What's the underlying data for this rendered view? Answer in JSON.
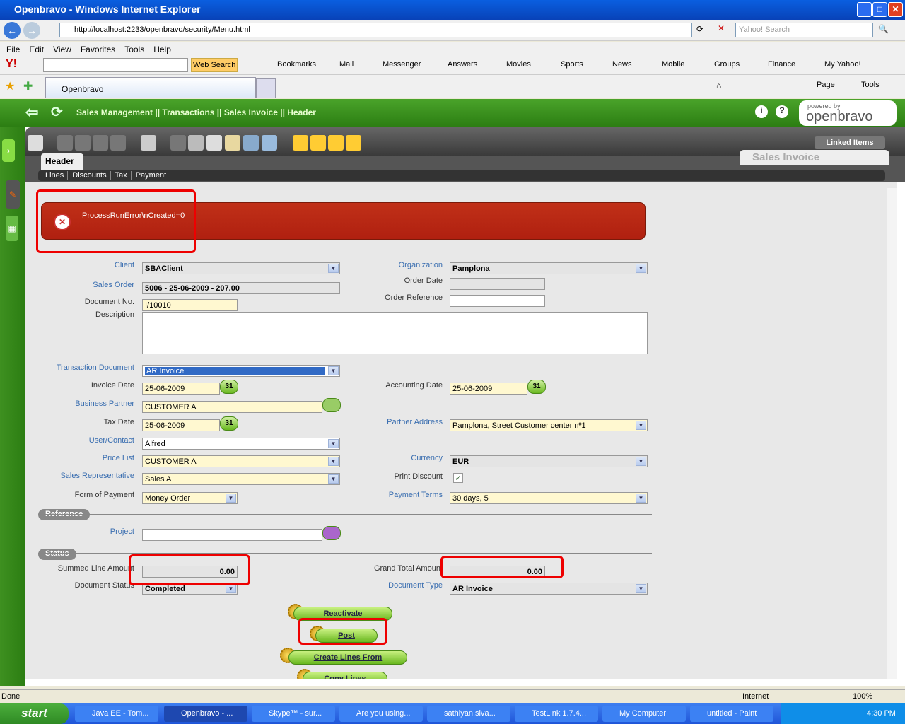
{
  "window": {
    "title": "Openbravo - Windows Internet Explorer",
    "url": "http://localhost:2233/openbravo/security/Menu.html",
    "search_placeholder": "Yahoo! Search"
  },
  "menu": [
    "File",
    "Edit",
    "View",
    "Favorites",
    "Tools",
    "Help"
  ],
  "yahoo_toolbar": {
    "web_search": "Web Search",
    "items": [
      "Bookmarks",
      "Mail",
      "Messenger",
      "Answers",
      "Movies",
      "Sports",
      "News",
      "Mobile",
      "Groups",
      "Finance",
      "My Yahoo!"
    ]
  },
  "ie_tab": "Openbravo",
  "ie_cmd": {
    "page": "Page",
    "tools": "Tools"
  },
  "app": {
    "breadcrumb": "Sales Management || Transactions || Sales Invoice || Header",
    "powered_by": "powered by",
    "logo": "openbravo",
    "linked_items": "Linked Items",
    "window_name": "Sales Invoice",
    "active_tab": "Header",
    "subtabs": [
      "Lines",
      "Discounts",
      "Tax",
      "Payment"
    ],
    "error_message": "ProcessRunError\\nCreated=0",
    "fields": [
      {
        "label": "Client",
        "value": "SBAClient",
        "type": "select"
      },
      {
        "label": "Organization",
        "value": "Pamplona",
        "type": "select"
      },
      {
        "label": "Sales Order",
        "value": "5006 - 25-06-2009 - 207.00",
        "type": "readonly"
      },
      {
        "label": "Order Date",
        "value": "",
        "type": "readonly"
      },
      {
        "label": "Document No.",
        "value": "I/10010",
        "type": "required"
      },
      {
        "label": "Order Reference",
        "value": "",
        "type": "text"
      },
      {
        "label": "Description",
        "value": "",
        "type": "textarea"
      },
      {
        "label": "Transaction Document",
        "value": "AR Invoice",
        "type": "select"
      },
      {
        "label": "Invoice Date",
        "value": "25-06-2009",
        "type": "date"
      },
      {
        "label": "Accounting Date",
        "value": "25-06-2009",
        "type": "date"
      },
      {
        "label": "Business Partner",
        "value": "CUSTOMER A",
        "type": "search"
      },
      {
        "label": "Tax Date",
        "value": "25-06-2009",
        "type": "date"
      },
      {
        "label": "Partner Address",
        "value": "Pamplona, Street Customer center nº1",
        "type": "select"
      },
      {
        "label": "User/Contact",
        "value": "Alfred",
        "type": "select"
      },
      {
        "label": "Price List",
        "value": "CUSTOMER A",
        "type": "select"
      },
      {
        "label": "Currency",
        "value": "EUR",
        "type": "select"
      },
      {
        "label": "Sales Representative",
        "value": "Sales A",
        "type": "select"
      },
      {
        "label": "Print Discount",
        "value": "✓",
        "type": "checkbox"
      },
      {
        "label": "Form of Payment",
        "value": "Money Order",
        "type": "select"
      },
      {
        "label": "Payment Terms",
        "value": "30 days, 5",
        "type": "select"
      },
      {
        "label": "Project",
        "value": "",
        "type": "search"
      },
      {
        "label": "Summed Line Amount",
        "value": "0.00",
        "type": "readonly"
      },
      {
        "label": "Grand Total Amount",
        "value": "0.00",
        "type": "readonly"
      },
      {
        "label": "Document Status",
        "value": "Completed",
        "type": "select"
      },
      {
        "label": "Document Type",
        "value": "AR Invoice",
        "type": "select"
      }
    ],
    "sections": {
      "reference": "Reference",
      "status": "Status"
    },
    "buttons": [
      "Reactivate",
      "Post",
      "Create Lines From",
      "Copy Lines"
    ]
  },
  "statusbar": {
    "left": "Done",
    "zone": "Internet",
    "zoom": "100%"
  },
  "taskbar": {
    "start": "start",
    "tasks": [
      "Java EE - Tom...",
      "Openbravo - ...",
      "Skype™ - sur...",
      "Are you using...",
      "sathiyan.siva...",
      "TestLink 1.7.4...",
      "My Computer",
      "untitled - Paint"
    ],
    "clock": "4:30 PM"
  }
}
